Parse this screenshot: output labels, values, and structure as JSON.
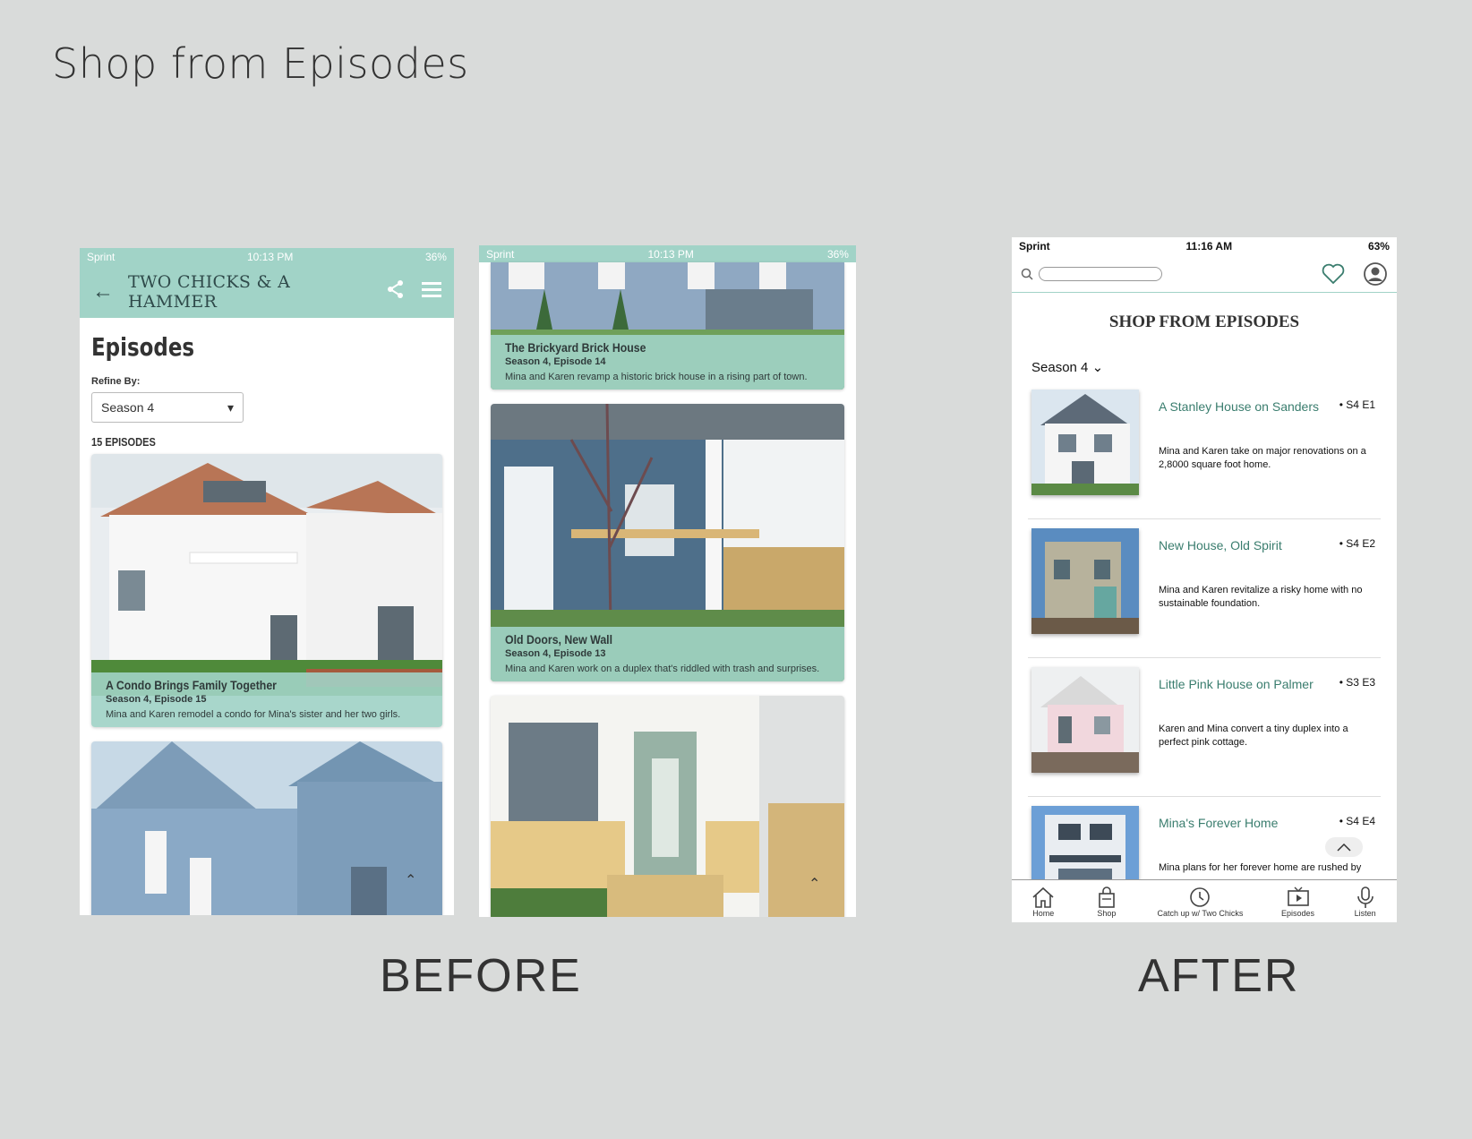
{
  "page": {
    "title": "Shop from Episodes",
    "before_label": "BEFORE",
    "after_label": "AFTER"
  },
  "before_phone_1": {
    "status": {
      "carrier": "Sprint",
      "time": "10:13 PM",
      "battery": "36%"
    },
    "header": {
      "brand": "TWO CHICKS & A HAMMER"
    },
    "heading": "Episodes",
    "refine_label": "Refine By:",
    "season_select": "Season 4",
    "episode_count": "15 EPISODES",
    "card": {
      "title": "A Condo Brings Family Together",
      "subtitle": "Season 4, Episode 15",
      "description": "Mina and Karen remodel a condo for Mina's sister and her two girls."
    }
  },
  "before_phone_2": {
    "status": {
      "carrier": "Sprint",
      "time": "10:13 PM",
      "battery": "36%"
    },
    "cards": [
      {
        "title": "The Brickyard Brick House",
        "subtitle": "Season 4, Episode 14",
        "description": "Mina and Karen revamp a historic brick house in a rising part of town."
      },
      {
        "title": "Old Doors, New Wall",
        "subtitle": "Season 4, Episode 13",
        "description": "Mina and Karen work on a duplex that's riddled with trash and surprises."
      }
    ]
  },
  "after_phone": {
    "status": {
      "carrier": "Sprint",
      "time": "11:16 AM",
      "battery": "63%"
    },
    "title": "SHOP FROM EPISODES",
    "season_select": "Season 4",
    "episodes": [
      {
        "name": "A Stanley House on Sanders",
        "code": "• S4 E1",
        "description": "Mina and Karen take on major renovations on a 2,8000 square foot home."
      },
      {
        "name": "New House, Old Spirit",
        "code": "• S4 E2",
        "description": "Mina and Karen revitalize a risky home with no sustainable foundation."
      },
      {
        "name": "Little Pink House on Palmer",
        "code": "• S3 E3",
        "description": "Karen and Mina convert a tiny duplex into a perfect pink cottage."
      },
      {
        "name": "Mina's Forever Home",
        "code": "• S4 E4",
        "description": "Mina plans for her forever home are rushed by"
      }
    ],
    "tabs": [
      "Home",
      "Shop",
      "Catch up w/ Two Chicks",
      "Episodes",
      "Listen"
    ]
  },
  "colors": {
    "mint": "#a1d3c7",
    "teal_text": "#3a7d6e",
    "background": "#d9dbda"
  }
}
